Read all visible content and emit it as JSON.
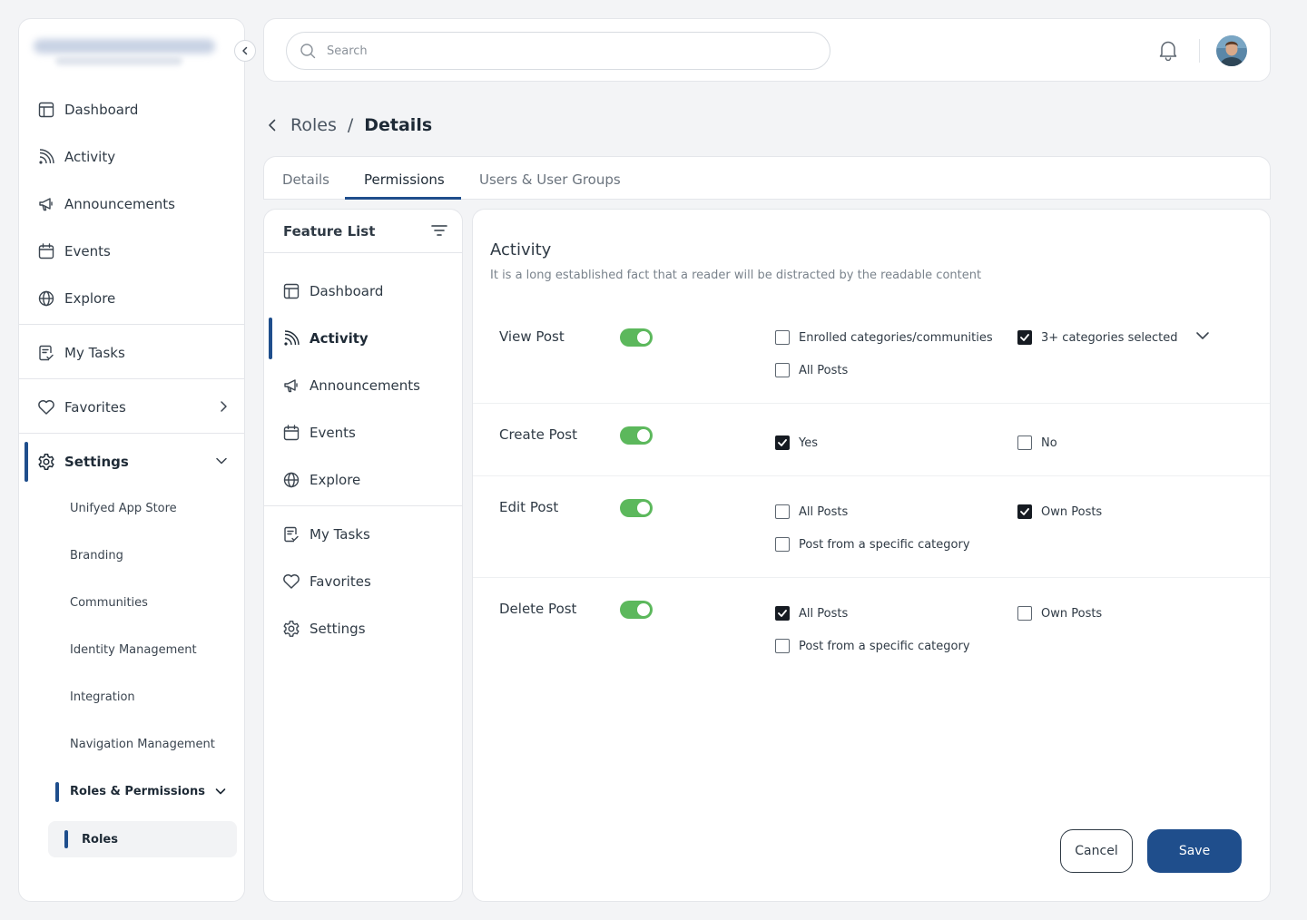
{
  "sidebar": {
    "nav": [
      {
        "label": "Dashboard",
        "icon": "dashboard-icon"
      },
      {
        "label": "Activity",
        "icon": "rss-icon"
      },
      {
        "label": "Announcements",
        "icon": "megaphone-icon"
      },
      {
        "label": "Events",
        "icon": "calendar-icon"
      },
      {
        "label": "Explore",
        "icon": "globe-icon"
      }
    ],
    "my_tasks": "My Tasks",
    "favorites": "Favorites",
    "settings": "Settings",
    "settings_sub": [
      "Unifyed App Store",
      "Branding",
      "Communities",
      "Identity Management",
      "Integration",
      "Navigation Management"
    ],
    "roles_permissions": "Roles & Permissions",
    "roles": "Roles"
  },
  "topbar": {
    "search_placeholder": "Search"
  },
  "breadcrumb": {
    "parent": "Roles",
    "separator": "/",
    "current": "Details"
  },
  "tabs": [
    "Details",
    "Permissions",
    "Users & User Groups"
  ],
  "active_tab": "Permissions",
  "feature_list": {
    "title": "Feature List",
    "items": [
      "Dashboard",
      "Activity",
      "Announcements",
      "Events",
      "Explore",
      "My Tasks",
      "Favorites",
      "Settings"
    ],
    "active": "Activity"
  },
  "panel": {
    "title": "Activity",
    "description": "It is a long established fact that a reader will be distracted by the readable content",
    "permissions": [
      {
        "label": "View Post",
        "enabled": true,
        "options": [
          {
            "label": "Enrolled categories/communities",
            "checked": false
          },
          {
            "label": "3+ categories selected",
            "checked": true
          },
          {
            "label": "All Posts",
            "checked": false
          }
        ]
      },
      {
        "label": "Create Post",
        "enabled": true,
        "options": [
          {
            "label": "Yes",
            "checked": true
          },
          {
            "label": "No",
            "checked": false
          }
        ]
      },
      {
        "label": "Edit Post",
        "enabled": true,
        "options": [
          {
            "label": "All Posts",
            "checked": false
          },
          {
            "label": "Own Posts",
            "checked": true
          },
          {
            "label": "Post from a specific category",
            "checked": false
          }
        ]
      },
      {
        "label": "Delete Post",
        "enabled": true,
        "options": [
          {
            "label": "All Posts",
            "checked": true
          },
          {
            "label": "Own Posts",
            "checked": false
          },
          {
            "label": "Post from a specific category",
            "checked": false
          }
        ]
      }
    ],
    "cancel": "Cancel",
    "save": "Save"
  },
  "colors": {
    "accent": "#1f4e8c",
    "toggle_on": "#5cb85c",
    "checkbox_on": "#161b22"
  }
}
